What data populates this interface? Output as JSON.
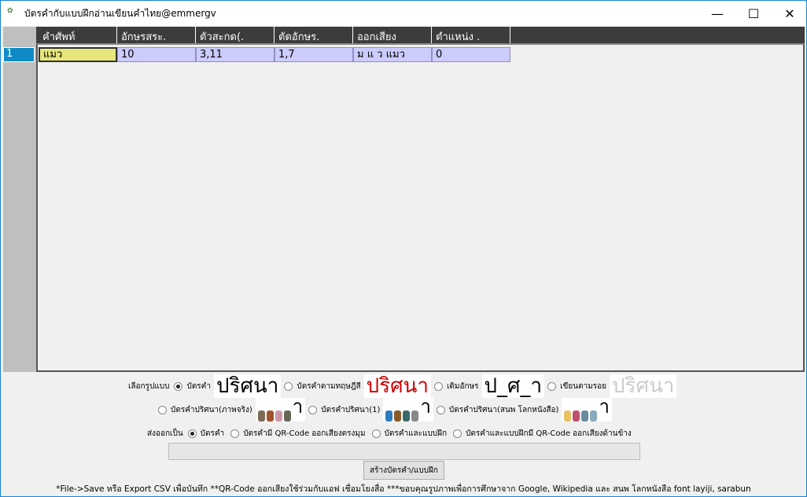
{
  "window": {
    "title": "บัตรคำกับแบบฝึกอ่านเขียนคำไทย@emmergv",
    "minimize": "—",
    "maximize": "☐",
    "close": "✕"
  },
  "grid": {
    "columns": [
      "คำศัพท์",
      "อักษรสระ.",
      "ตัวสะกด(.",
      "ตัดอักษร.",
      "ออกเสียง",
      "ตำแหน่ง ."
    ],
    "rows": [
      {
        "num": "1",
        "cells": [
          "แมว",
          "10",
          "3,11",
          "1,7",
          "ม แ ว  แมว",
          "0"
        ]
      }
    ]
  },
  "style_options": {
    "label": "เลือกรูปแบบ",
    "items": [
      {
        "label": "บัตรคำ",
        "checked": true,
        "sample": "ปริศนา"
      },
      {
        "label": "บัตรคำตามทฤษฎีสี",
        "checked": false,
        "sample": "ปริศนา"
      },
      {
        "label": "เติมอักษร",
        "checked": false,
        "sample": "ป_ศ_า"
      },
      {
        "label": "เขียนตามรอย",
        "checked": false,
        "sample": "ปริศนา"
      },
      {
        "label": "บัตรคำปริศนา(ภาพจริง)",
        "checked": false
      },
      {
        "label": "บัตรคำปริศนา(1)",
        "checked": false
      },
      {
        "label": "บัตรคำปริศนา(สนพ โลกหนังสือ)",
        "checked": false
      }
    ],
    "pic_suffix": "า"
  },
  "export_options": {
    "label": "ส่งออกเป็น",
    "items": [
      {
        "label": "บัตรคำ",
        "checked": true
      },
      {
        "label": "บัตรคำมี QR-Code ออกเสียงตรงมุม",
        "checked": false
      },
      {
        "label": "บัตรคำและแบบฝึก",
        "checked": false
      },
      {
        "label": "บัตรคำและแบบฝึกมี QR-Code ออกเสียงด้านข้าง",
        "checked": false
      }
    ]
  },
  "progress": 0,
  "create_button": "สร้างบัตรคำ/แบบฝึก",
  "footer": "*File->Save หรือ Export CSV เพื่อบันทึก **QR-Code ออกเสียงใช้ร่วมกับแอฟ เชื่อมโยงสื่อ ***ขอบคุณรูปภาพเพื่อการศึกษาจาก Google, Wikipedia และ สนพ โลกหนังสือ font layiji, sarabun"
}
